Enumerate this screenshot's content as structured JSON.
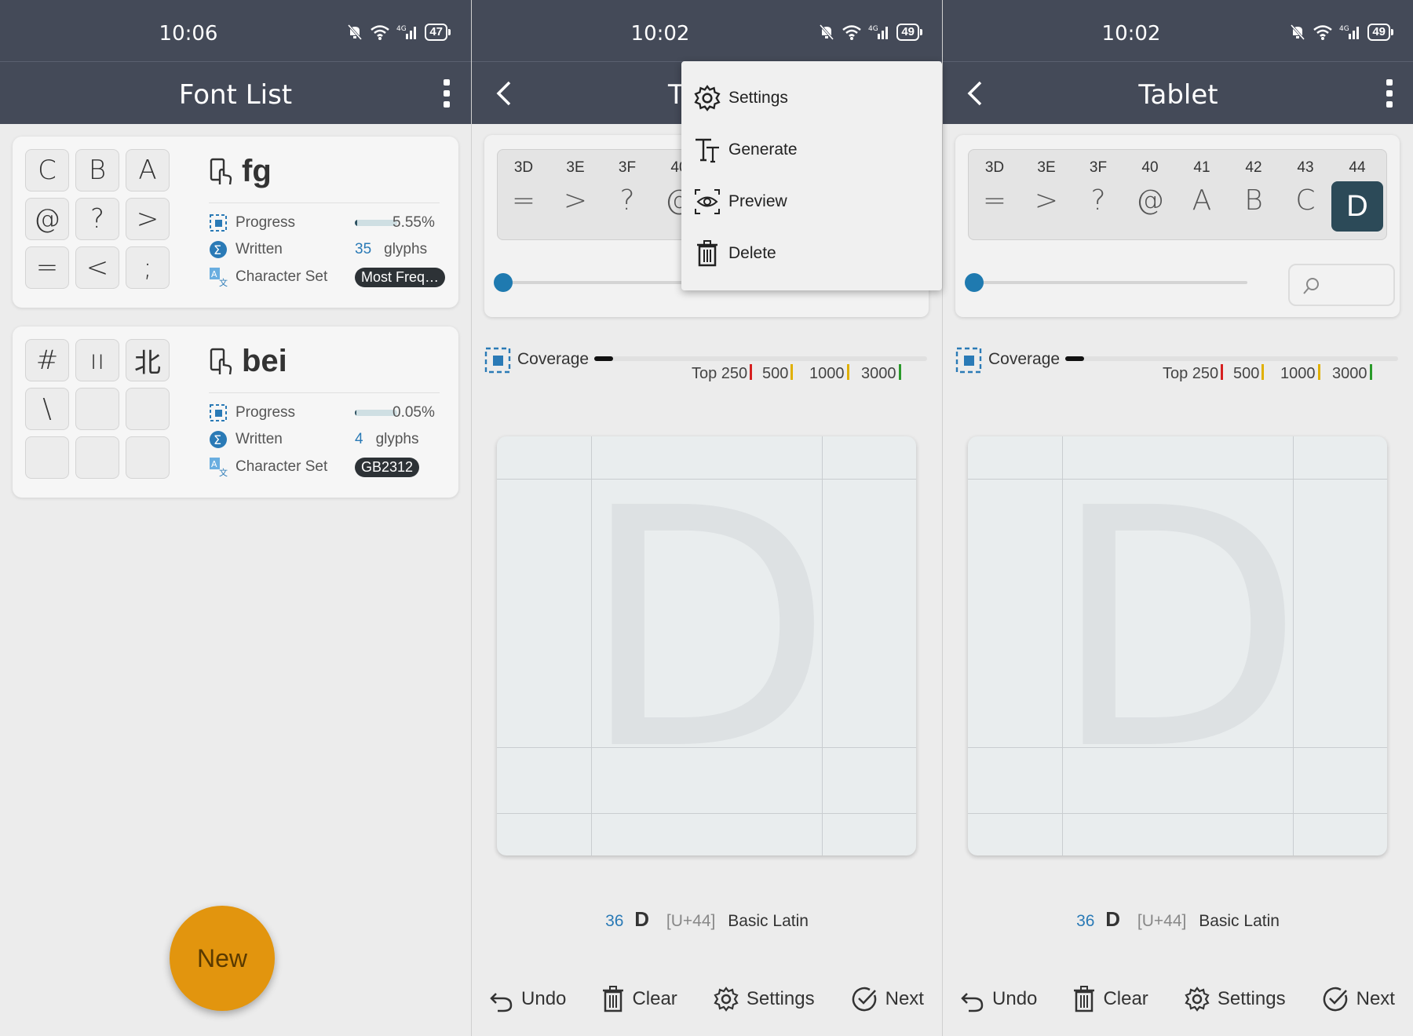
{
  "status": {
    "s1_time": "10:06",
    "s1_battery": "47",
    "s2_time": "10:02",
    "s2_battery": "49",
    "s3_time": "10:02",
    "s3_battery": "49",
    "network": "4G"
  },
  "font_list": {
    "title": "Font List",
    "fonts": [
      {
        "name": "fg",
        "glyphs": [
          "C",
          "B",
          "A",
          "@",
          "?",
          ">",
          "=",
          "<",
          ";"
        ],
        "progress_label": "Progress",
        "progress_pct": "5.55%",
        "progress_value": 0.0555,
        "written_label": "Written",
        "written_count": "35",
        "written_unit": "glyphs",
        "charset_label": "Character Set",
        "charset": "Most Freq…"
      },
      {
        "name": "bei",
        "glyphs": [
          "#",
          "ıı",
          "北",
          "\\",
          "",
          "",
          "",
          "",
          ""
        ],
        "progress_label": "Progress",
        "progress_pct": "0.05%",
        "progress_value": 0.0005,
        "written_label": "Written",
        "written_count": "4",
        "written_unit": "glyphs",
        "charset_label": "Character Set",
        "charset": "GB2312"
      }
    ],
    "new_button": "New"
  },
  "editor": {
    "title_partial": "T",
    "title": "Tablet",
    "strip_codes_s2": [
      "3D",
      "3E",
      "3F",
      "40"
    ],
    "strip_chars_s2": [
      "=",
      ">",
      "?",
      "@"
    ],
    "strip_codes_s3": [
      "3D",
      "3E",
      "3F",
      "40",
      "41",
      "42",
      "43",
      "44"
    ],
    "strip_chars_s3": [
      "=",
      ">",
      "?",
      "@",
      "A",
      "B",
      "C",
      "D"
    ],
    "selected_index": 7,
    "coverage_label": "Coverage",
    "coverage_markers": [
      {
        "label": "Top 250",
        "color": "#d62020"
      },
      {
        "label": "500",
        "color": "#e0b000"
      },
      {
        "label": "1000",
        "color": "#e0b000"
      },
      {
        "label": "3000",
        "color": "#2a9a2a"
      }
    ],
    "ghost_char": "D",
    "char_index": "36",
    "char": "D",
    "unicode": "[U+44]",
    "block": "Basic Latin",
    "toolbar": {
      "undo": "Undo",
      "clear": "Clear",
      "settings": "Settings",
      "next": "Next"
    }
  },
  "menu": {
    "settings": "Settings",
    "generate": "Generate",
    "preview": "Preview",
    "delete": "Delete"
  },
  "colors": {
    "bar": "#444a58",
    "accent": "#1f7ab0",
    "fab": "#e2950e",
    "selected": "#2c4a58"
  }
}
